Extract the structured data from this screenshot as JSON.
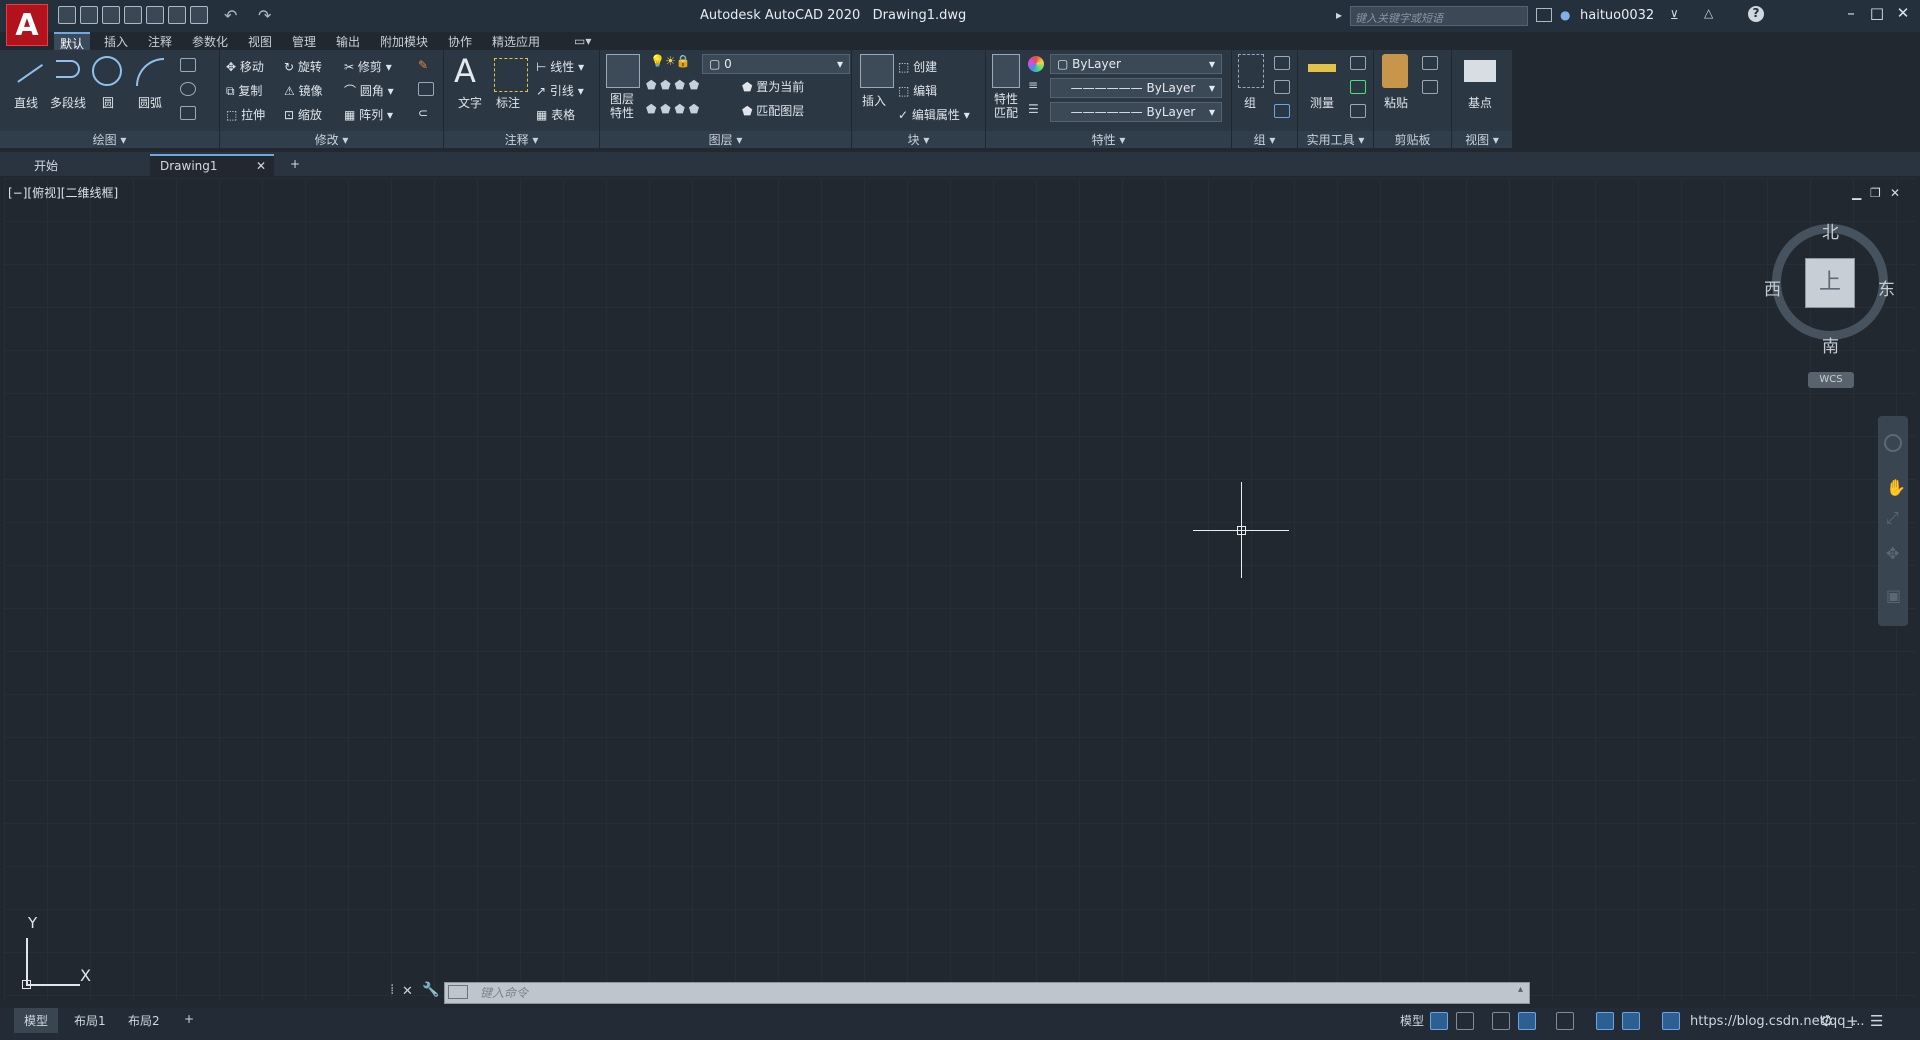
{
  "title": {
    "app": "Autodesk AutoCAD 2020",
    "file": "Drawing1.dwg",
    "search_placeholder": "键入关键字或短语",
    "user": "haituo0032"
  },
  "menus": [
    "默认",
    "插入",
    "注释",
    "参数化",
    "视图",
    "管理",
    "输出",
    "附加模块",
    "协作",
    "精选应用"
  ],
  "ribbon": {
    "draw": {
      "label": "绘图",
      "line": "直线",
      "polyline": "多段线",
      "circle": "圆",
      "arc": "圆弧"
    },
    "modify": {
      "label": "修改",
      "move": "移动",
      "rotate": "旋转",
      "trim": "修剪",
      "copy": "复制",
      "mirror": "镜像",
      "fillet": "圆角",
      "stretch": "拉伸",
      "scale": "缩放",
      "array": "阵列"
    },
    "annotation": {
      "label": "注释",
      "text": "文字",
      "dimension": "标注",
      "linear": "线性",
      "leader": "引线",
      "table": "表格"
    },
    "layers": {
      "label": "图层",
      "props_line1": "图层",
      "props_line2": "特性",
      "current_layer": "0",
      "set_current": "置为当前",
      "match_layer": "匹配图层"
    },
    "block": {
      "label": "块",
      "insert": "插入",
      "create": "创建",
      "edit": "编辑",
      "edit_attr": "编辑属性"
    },
    "properties": {
      "label": "特性",
      "match_line1": "特性",
      "match_line2": "匹配",
      "color": "ByLayer",
      "linetype": "ByLayer",
      "lineweight": "ByLayer"
    },
    "groups": {
      "label": "组",
      "group": "组"
    },
    "utilities": {
      "label": "实用工具",
      "measure": "测量"
    },
    "clipboard": {
      "label": "剪贴板",
      "paste": "粘贴"
    },
    "view": {
      "label": "视图",
      "base": "基点"
    }
  },
  "doc_tabs": {
    "start": "开始",
    "drawing": "Drawing1",
    "add": "+"
  },
  "viewport_label": "[−][俯视][二维线框]",
  "viewcube": {
    "north": "北",
    "south": "南",
    "east": "东",
    "west": "西",
    "top": "上",
    "wcs": "WCS"
  },
  "ucs": {
    "x": "X",
    "y": "Y"
  },
  "command_placeholder": "键入命令",
  "layout_tabs": [
    "模型",
    "布局1",
    "布局2",
    "+"
  ],
  "status": {
    "model": "模型",
    "watermark": "https://blog.csdn.net/qq_..."
  },
  "colors": {
    "accent": "#6ea9e0",
    "logo": "#b1121c",
    "background": "#212830"
  }
}
